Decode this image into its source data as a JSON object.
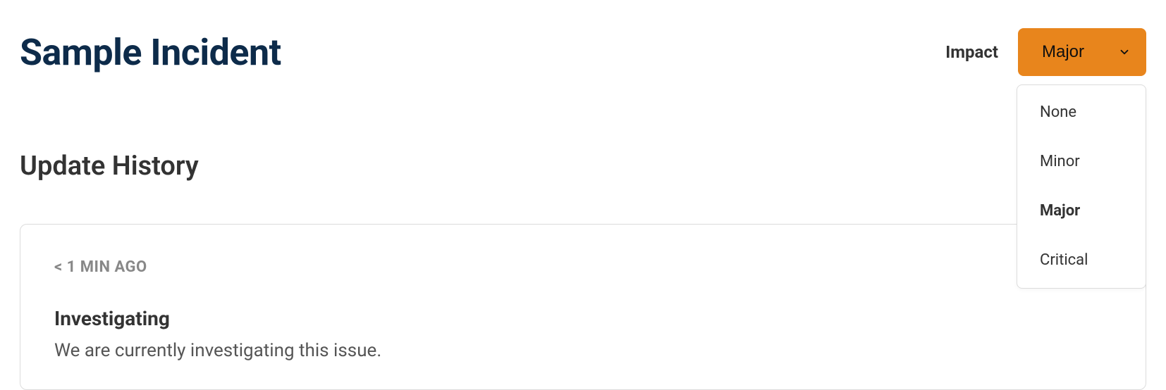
{
  "header": {
    "title": "Sample Incident",
    "impact_label": "Impact",
    "impact_selected": "Major"
  },
  "impact_options": [
    {
      "label": "None",
      "selected": false
    },
    {
      "label": "Minor",
      "selected": false
    },
    {
      "label": "Major",
      "selected": true
    },
    {
      "label": "Critical",
      "selected": false
    }
  ],
  "section": {
    "title": "Update History"
  },
  "updates": [
    {
      "time": "< 1 MIN AGO",
      "status": "Investigating",
      "message": "We are currently investigating this issue."
    }
  ],
  "colors": {
    "brand_orange": "#e8851c",
    "title_navy": "#0d2b4a"
  }
}
